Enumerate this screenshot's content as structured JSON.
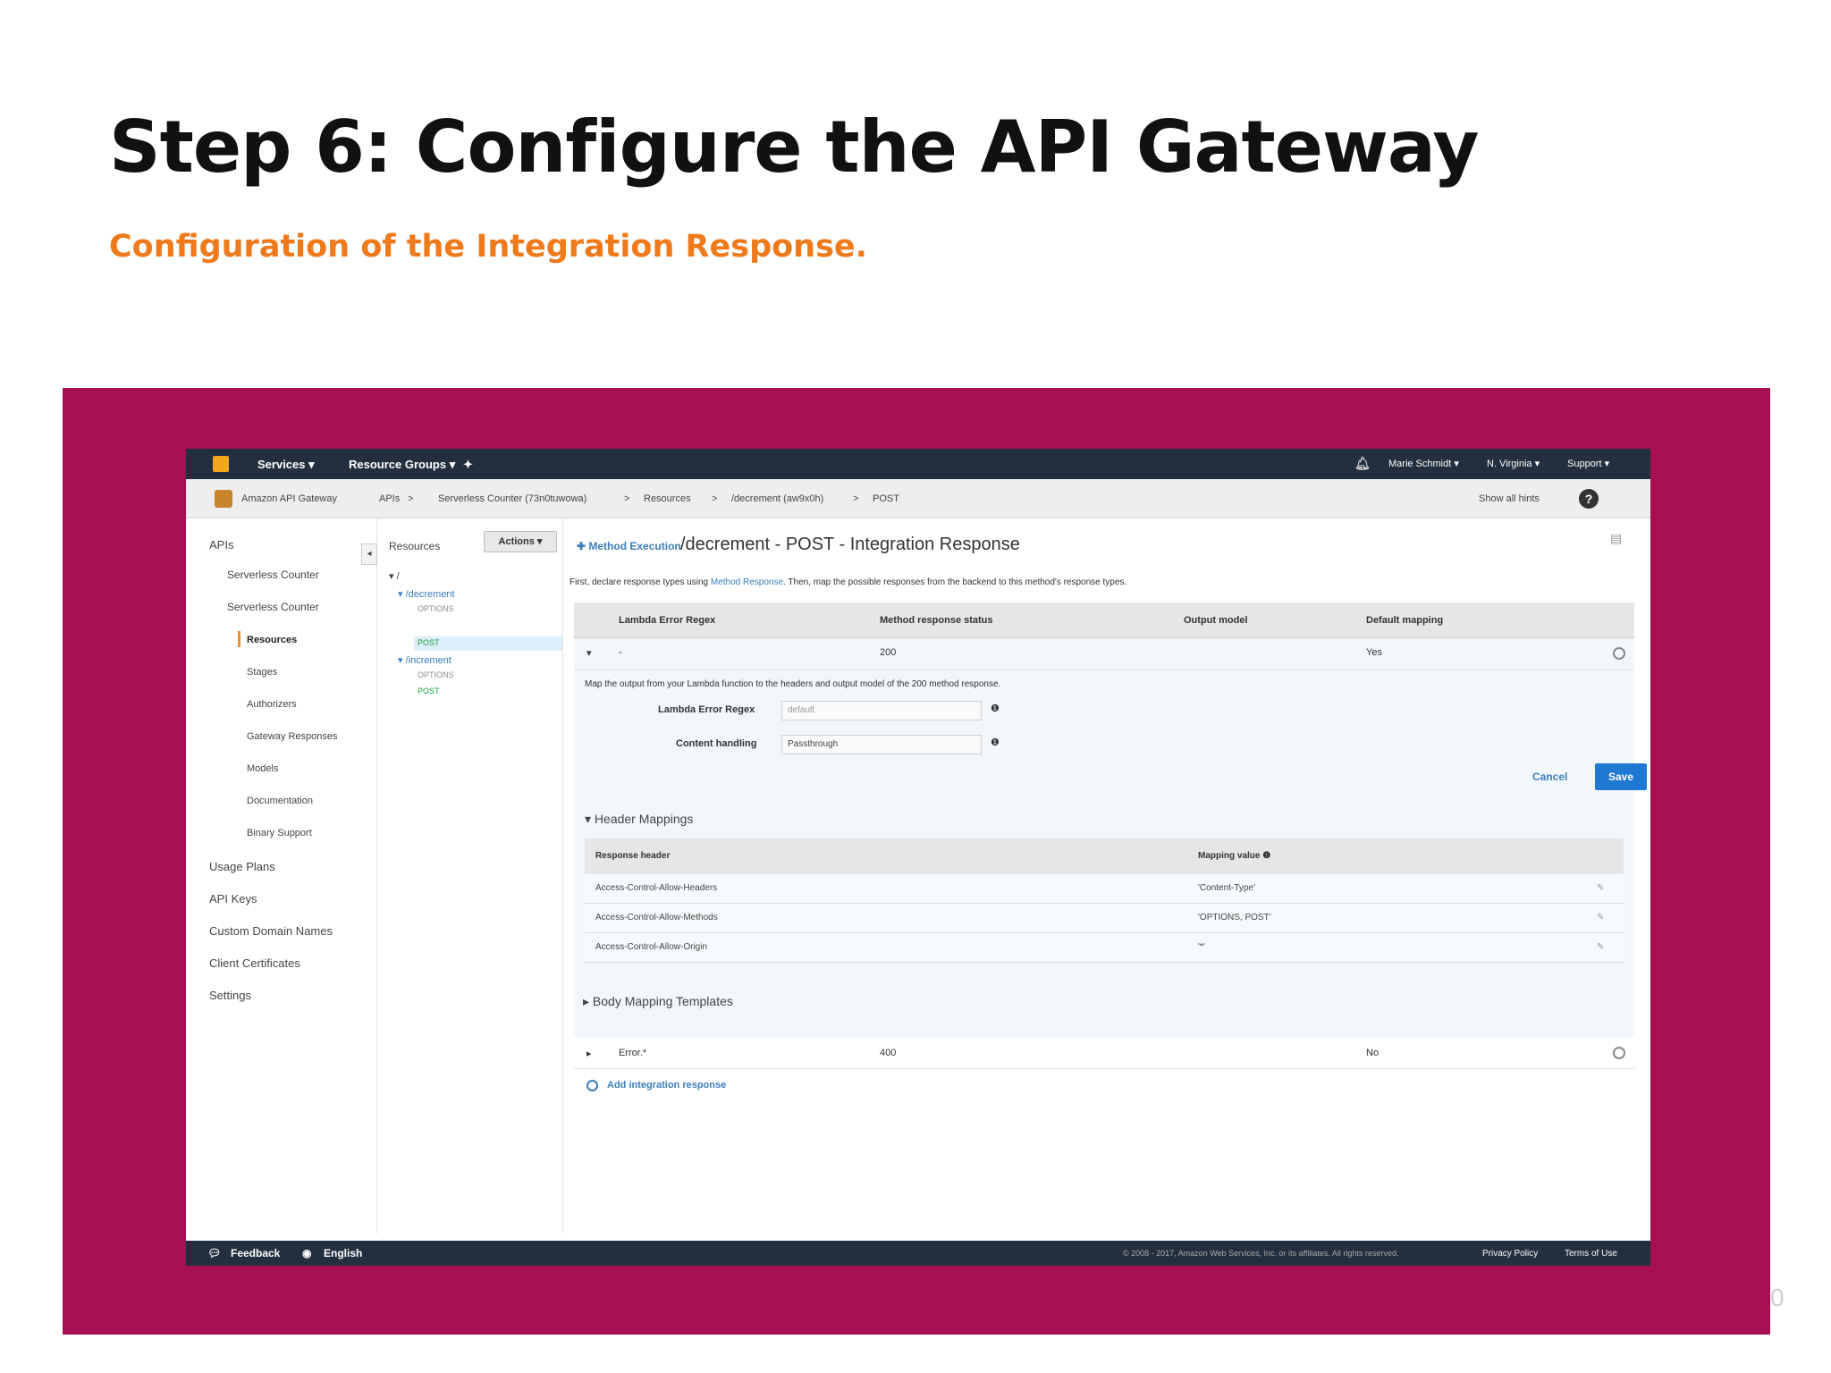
{
  "slide": {
    "title": "Step 6: Configure the API Gateway",
    "subtitle": "Configuration of the Integration Response.",
    "page_number": "0",
    "colors": {
      "title": "#111111",
      "subtitle": "#ee7a1b",
      "frame": "#a61052"
    }
  },
  "topnav": {
    "services": "Services ▾",
    "resource_groups": "Resource Groups ▾",
    "user": "Marie Schmidt ▾",
    "region": "N. Virginia ▾",
    "support": "Support ▾"
  },
  "breadcrumbs": {
    "service": "Amazon API Gateway",
    "apis": "APIs",
    "api": "Serverless Counter (73n0tuwowa)",
    "resources": "Resources",
    "resource": "/decrement (aw9x0h)",
    "method": "POST",
    "show_hints": "Show all hints"
  },
  "leftnav": {
    "apis": "APIs",
    "api1": "Serverless Counter",
    "api2": "Serverless Counter",
    "resources": "Resources",
    "stages": "Stages",
    "authorizers": "Authorizers",
    "gateway_responses": "Gateway Responses",
    "models": "Models",
    "documentation": "Documentation",
    "binary_support": "Binary Support",
    "usage_plans": "Usage Plans",
    "api_keys": "API Keys",
    "custom_domain_names": "Custom Domain Names",
    "client_certificates": "Client Certificates",
    "settings": "Settings"
  },
  "resources_panel": {
    "title": "Resources",
    "actions": "Actions ▾",
    "root": "▾ /",
    "decrement": "▾ /decrement",
    "decrement_options": "OPTIONS",
    "decrement_post": "POST",
    "increment": "▾ /increment",
    "increment_options": "OPTIONS",
    "increment_post": "POST"
  },
  "main": {
    "method_execution": "✚ Method Execution",
    "heading": "/decrement - POST - Integration Response",
    "description_pre": "First, declare response types using ",
    "description_link": "Method Response",
    "description_post": ". Then, map the possible responses from the backend to this method's response types.",
    "columns": {
      "lambda_error_regex": "Lambda Error Regex",
      "method_response_status": "Method response status",
      "output_model": "Output model",
      "default_mapping": "Default mapping"
    },
    "row_200": {
      "regex": "-",
      "status": "200",
      "default": "Yes"
    },
    "map_text": "Map the output from your Lambda function to the headers and output model of the 200 method response.",
    "regex_label": "Lambda Error Regex",
    "regex_placeholder": "default",
    "content_handling_label": "Content handling",
    "content_handling_value": "Passthrough",
    "cancel": "Cancel",
    "save": "Save",
    "header_mappings": "▾ Header Mappings",
    "hm_columns": {
      "response_header": "Response header",
      "mapping_value": "Mapping value ❶"
    },
    "hm_rows": [
      {
        "header": "Access-Control-Allow-Headers",
        "value": "'Content-Type'"
      },
      {
        "header": "Access-Control-Allow-Methods",
        "value": "'OPTIONS, POST'"
      },
      {
        "header": "Access-Control-Allow-Origin",
        "value": "'*'"
      }
    ],
    "body_mapping": "▸ Body Mapping Templates",
    "row_400": {
      "regex": "Error.*",
      "status": "400",
      "default": "No"
    },
    "add_integration_response": "Add integration response"
  },
  "footer": {
    "feedback": "Feedback",
    "language": "English",
    "copyright": "© 2008 - 2017, Amazon Web Services, Inc. or its affiliates. All rights reserved.",
    "privacy": "Privacy Policy",
    "terms": "Terms of Use"
  }
}
